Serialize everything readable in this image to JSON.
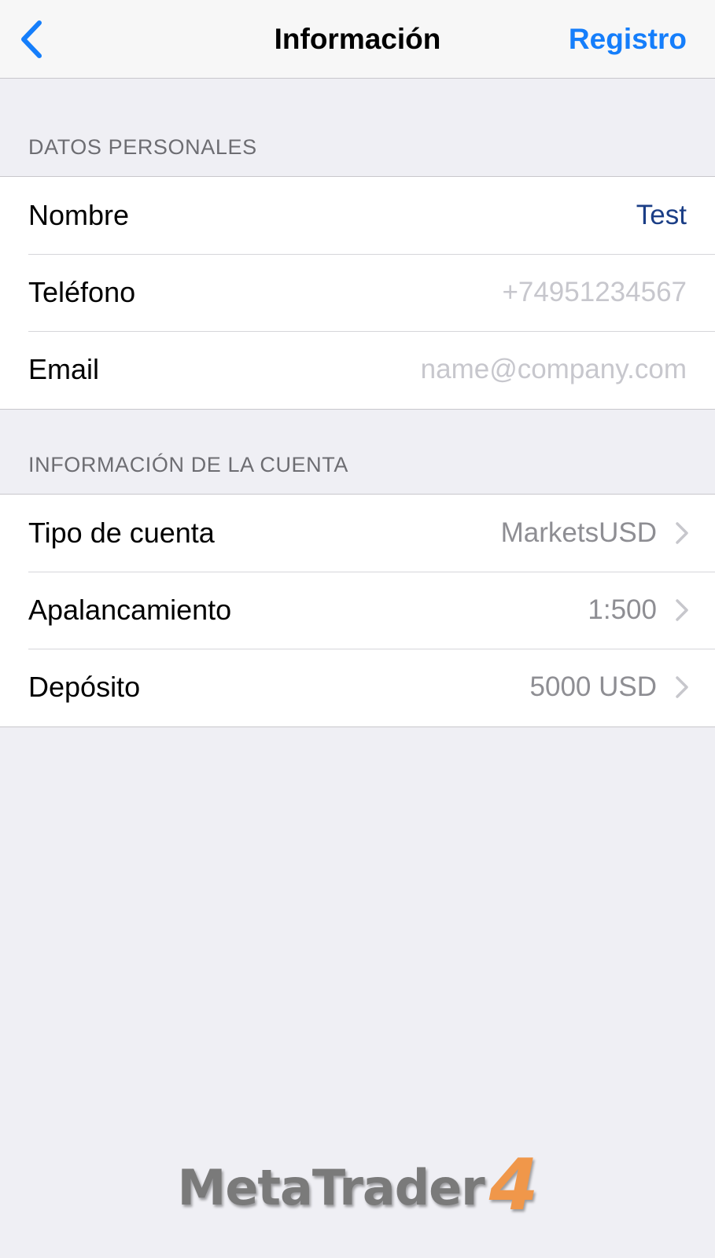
{
  "nav": {
    "back_icon": "chevron-left-icon",
    "title": "Información",
    "action_label": "Registro",
    "accent_color": "#157efb"
  },
  "personal": {
    "header": "DATOS PERSONALES",
    "rows": [
      {
        "label": "Nombre",
        "value": "Test"
      },
      {
        "label": "Teléfono",
        "placeholder": "+74951234567"
      },
      {
        "label": "Email",
        "placeholder": "name@company.com"
      }
    ]
  },
  "account": {
    "header": "INFORMACIÓN DE LA CUENTA",
    "rows": [
      {
        "label": "Tipo de cuenta",
        "value": "MarketsUSD",
        "icon": "chevron-right-icon"
      },
      {
        "label": "Apalancamiento",
        "value": "1:500",
        "icon": "chevron-right-icon"
      },
      {
        "label": "Depósito",
        "value": "5000 USD",
        "icon": "chevron-right-icon"
      }
    ]
  },
  "logo": {
    "text": "MetaTrader",
    "number": "4",
    "number_color": "#f0974a"
  }
}
